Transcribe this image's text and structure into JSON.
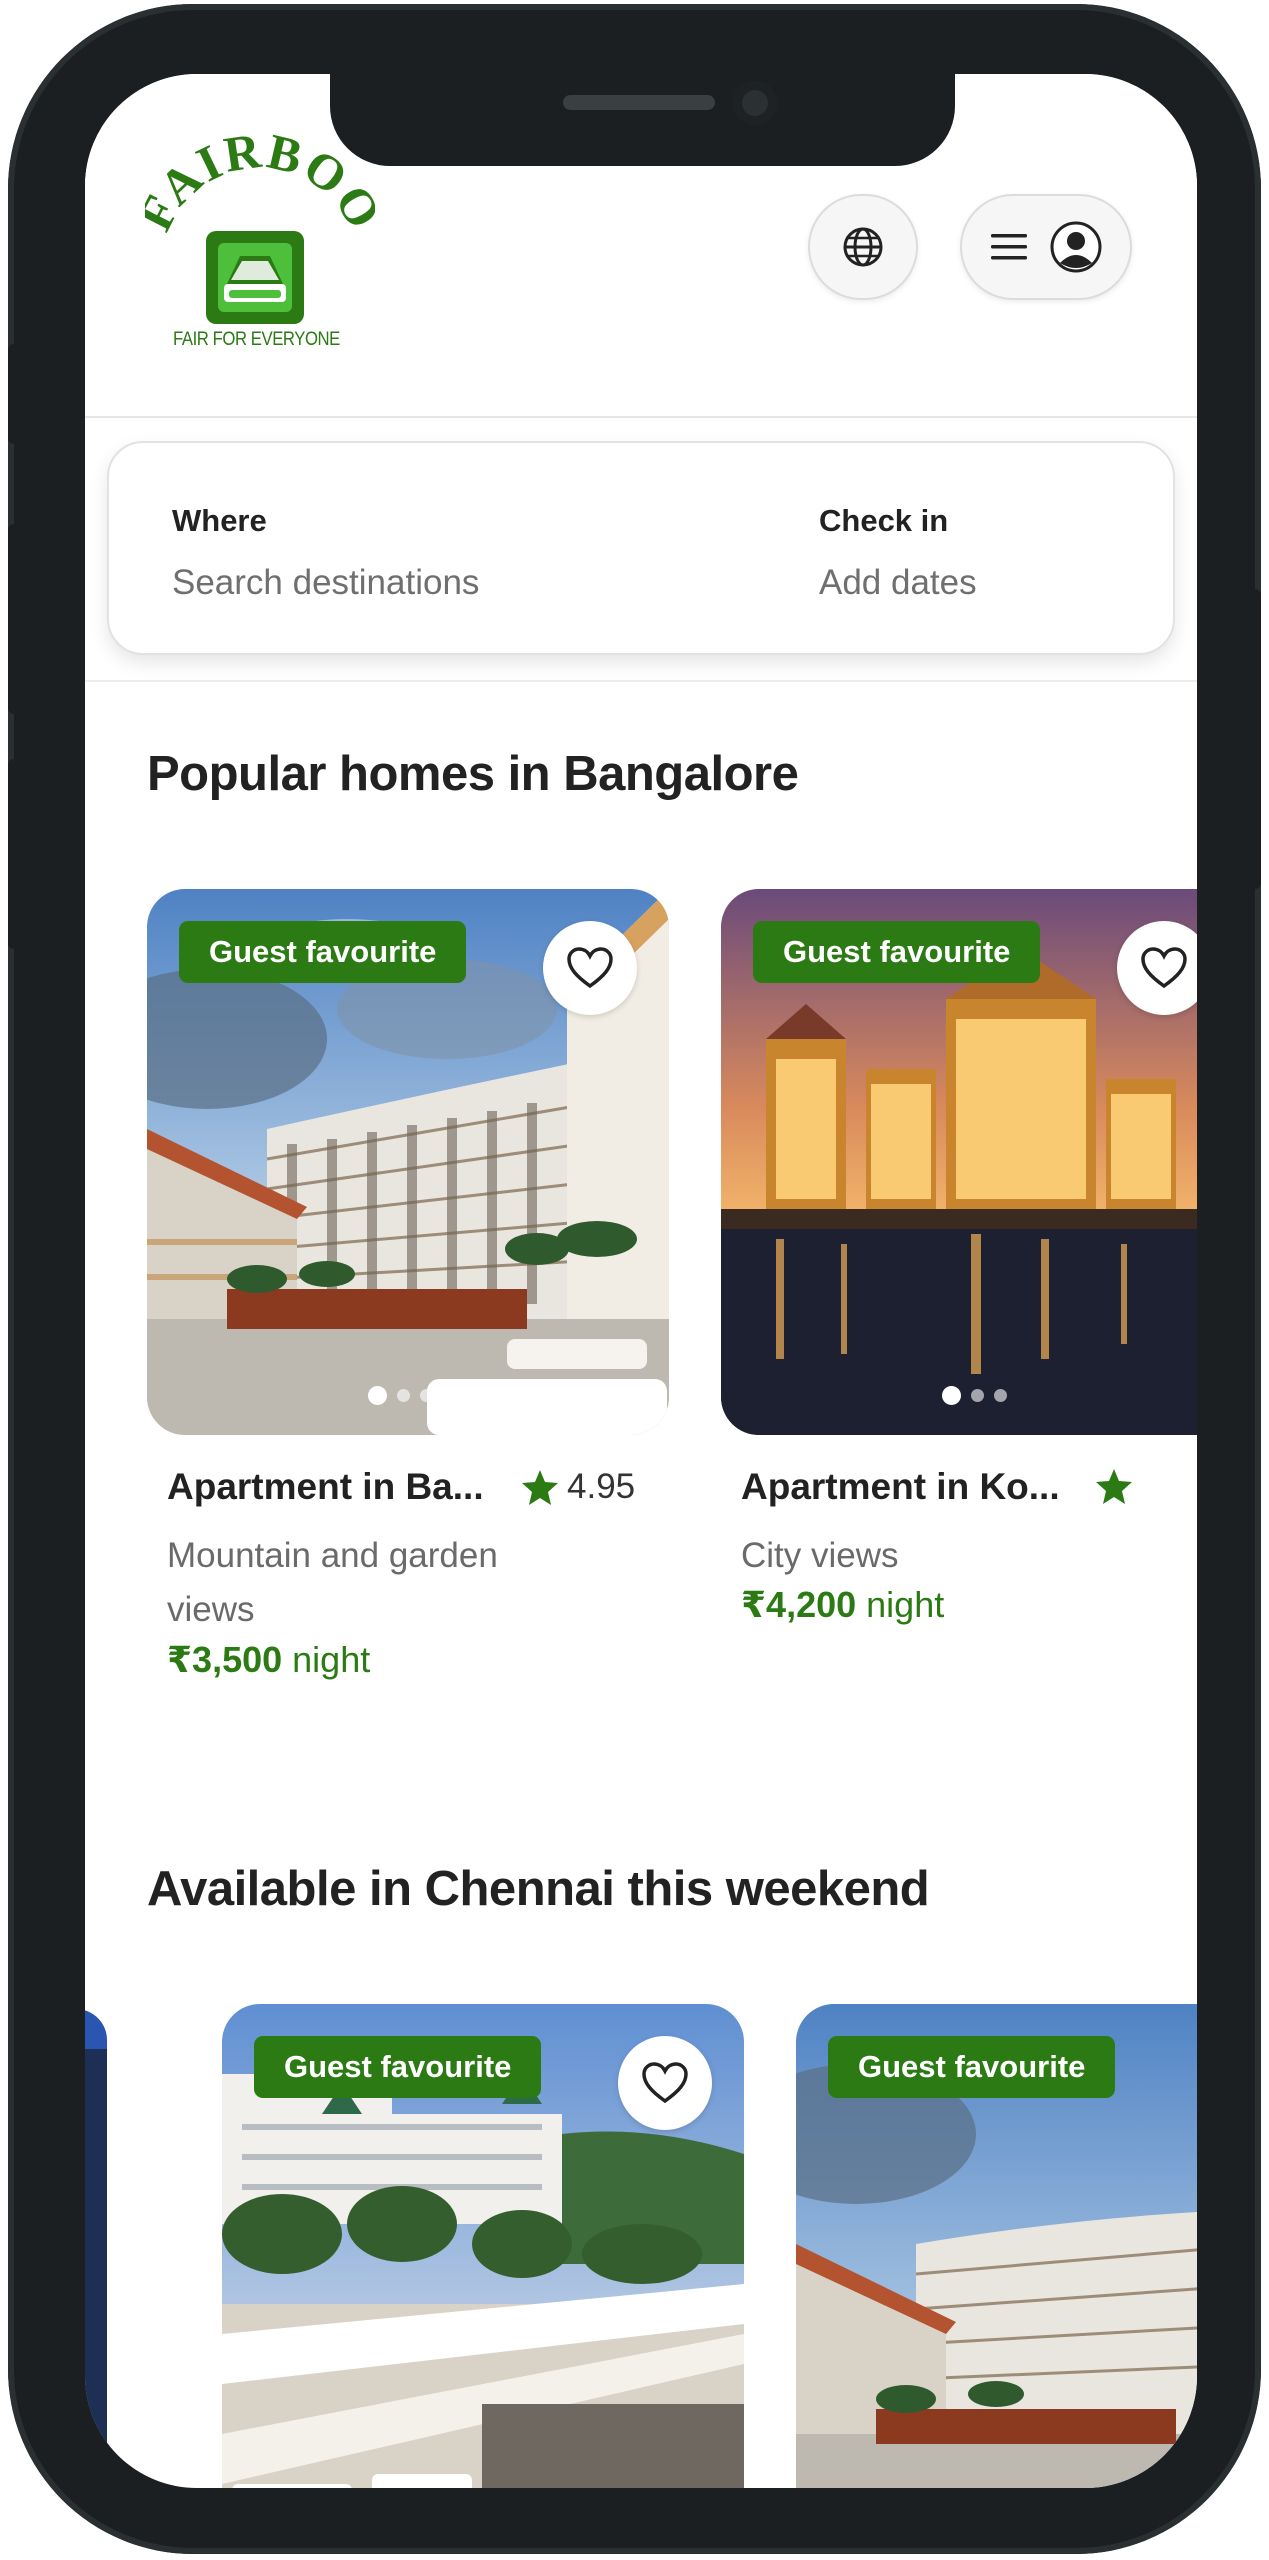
{
  "brand": {
    "logo_text": "FAIRBOO",
    "tagline": "FAIR FOR EVERYONE",
    "color": "#2b7a14"
  },
  "header": {
    "language_icon": "globe-icon",
    "menu_icon": "hamburger-icon",
    "profile_icon": "user-circle-icon"
  },
  "search": {
    "where_label": "Where",
    "where_placeholder": "Search destinations",
    "checkin_label": "Check in",
    "checkin_placeholder": "Add dates"
  },
  "sections": [
    {
      "title": "Popular homes in Bangalore",
      "listings": [
        {
          "badge": "Guest favourite",
          "title": "Apartment in Ba...",
          "rating": "4.95",
          "subtitle": "Mountain and garden views",
          "price": "₹3,500",
          "price_unit": "night"
        },
        {
          "badge": "Guest favourite",
          "title": "Apartment in Ko...",
          "subtitle": "City views",
          "price": "₹4,200",
          "price_unit": "night"
        }
      ]
    },
    {
      "title": "Available in Chennai this weekend",
      "listings": [
        {
          "badge": "Guest favourite"
        },
        {
          "badge": "Guest favourite"
        }
      ]
    }
  ],
  "colors": {
    "accent": "#2b7a14",
    "frame": "#1b1f21"
  }
}
